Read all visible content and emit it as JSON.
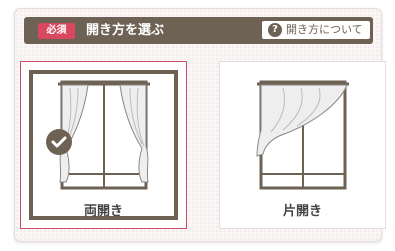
{
  "header": {
    "required_label": "必須",
    "title": "開き方を選ぶ",
    "help_icon": "question-circle-icon",
    "help_label": "開き方について"
  },
  "options": [
    {
      "label": "両開き",
      "selected": true,
      "icon": "double-curtain-icon"
    },
    {
      "label": "片開き",
      "selected": false,
      "icon": "single-curtain-icon"
    }
  ],
  "colors": {
    "header_bg": "#6e6255",
    "required_badge": "#d9485f",
    "selected_border": "#c94b6d"
  }
}
